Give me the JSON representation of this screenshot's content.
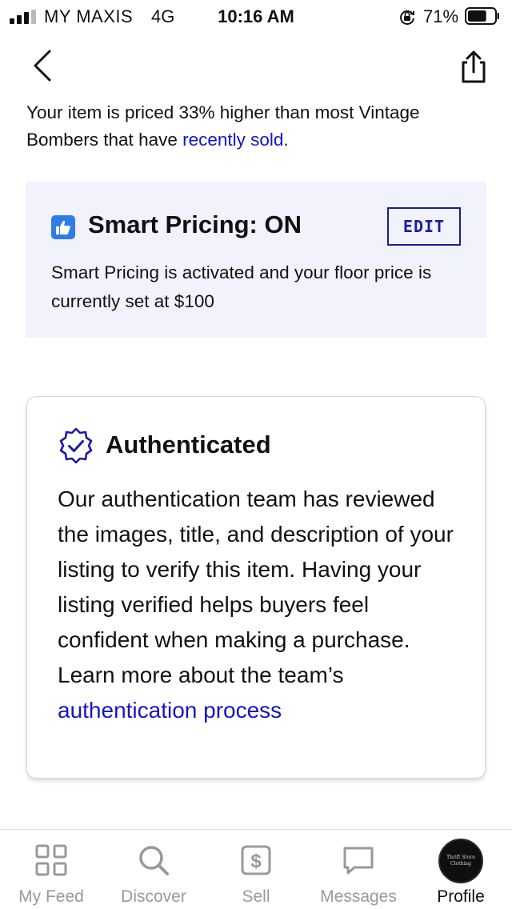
{
  "status_bar": {
    "carrier": "MY MAXIS",
    "network": "4G",
    "time": "10:16 AM",
    "battery_percent": "71%",
    "battery_level": 0.71,
    "signal_bars": 3,
    "icons": [
      "signal-icon",
      "rotation-lock-icon",
      "battery-icon"
    ]
  },
  "nav": {
    "back_icon": "chevron-left-icon",
    "share_icon": "share-icon"
  },
  "intro": {
    "text_before": "Your item is priced 33% higher than most Vintage Bombers that have ",
    "link": "recently sold",
    "text_after": "."
  },
  "smart_pricing": {
    "icon": "thumbs-up-icon",
    "title": "Smart Pricing: ON",
    "edit_label": "EDIT",
    "description": "Smart Pricing is activated and your floor price is currently set at $100",
    "accent_color": "#2f7de8",
    "panel_color": "#f1f2fb"
  },
  "authenticated": {
    "icon": "verified-badge-icon",
    "title": "Authenticated",
    "body": "Our authentication team has reviewed the images, title, and description of your listing to verify this item. Having your listing verified helps buyers feel confident when making a purchase. Learn more about the team’s ",
    "link": "authentication process"
  },
  "tabs": [
    {
      "label": "My Feed",
      "icon": "feed-grid-icon",
      "active": false
    },
    {
      "label": "Discover",
      "icon": "search-icon",
      "active": false
    },
    {
      "label": "Sell",
      "icon": "dollar-tag-icon",
      "active": false
    },
    {
      "label": "Messages",
      "icon": "chat-bubble-icon",
      "active": false
    },
    {
      "label": "Profile",
      "icon": "avatar",
      "active": true
    }
  ],
  "profile_avatar_text": "Thrift Store Clothing",
  "colors": {
    "link": "#1414c8",
    "edit_border": "#1a1aa6",
    "tab_inactive": "#999999",
    "tab_active": "#111111"
  }
}
